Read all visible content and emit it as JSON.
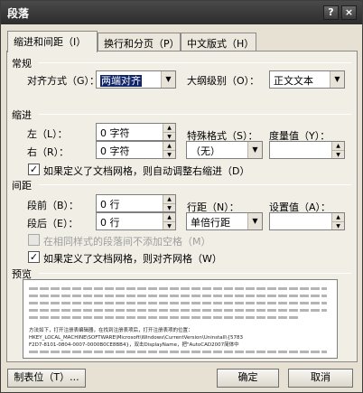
{
  "window": {
    "title": "段落",
    "help_label": "?",
    "close_label": "×"
  },
  "tabs": [
    {
      "label": "缩进和间距（I）",
      "active": true
    },
    {
      "label": "换行和分页（P）",
      "active": false
    },
    {
      "label": "中文版式（H）",
      "active": false
    }
  ],
  "general": {
    "heading": "常规",
    "alignment_label": "对齐方式（G）：",
    "alignment_value": "两端对齐",
    "outline_label": "大纲级别（O）：",
    "outline_value": "正文文本"
  },
  "indent": {
    "heading": "缩进",
    "left_label": "左（L）：",
    "left_value": "0 字符",
    "right_label": "右（R）：",
    "right_value": "0 字符",
    "special_label": "特殊格式（S）：",
    "special_value": "（无）",
    "measure_label": "度量值（Y）：",
    "measure_value": "",
    "auto_adjust_label": "如果定义了文档网格，则自动调整右缩进（D）",
    "auto_adjust_checked": true
  },
  "spacing": {
    "heading": "间距",
    "before_label": "段前（B）：",
    "before_value": "0 行",
    "after_label": "段后（E）：",
    "after_value": "0 行",
    "line_spacing_label": "行距（N）：",
    "line_spacing_value": "单倍行距",
    "set_value_label": "设置值（A）：",
    "set_value_value": "",
    "no_space_label": "在相同样式的段落间不添加空格（M）",
    "no_space_checked": false,
    "no_space_disabled": true,
    "snap_grid_label": "如果定义了文档网格，则对齐网格（W）",
    "snap_grid_checked": true
  },
  "preview": {
    "heading": "预览",
    "text_lines": [
      "方法如下，打开注册表编辑器，在找到注册表项后，打开注册表项的位置：",
      "HKEY_LOCAL_MACHINE\\SOFTWARE\\Microsoft\\Windows\\CurrentVersion\\Uninstall\\{5783",
      "F2D7-8101-0804-0007-0000B0CE8BB4}，双击DisplayName，把\"AutoCAD2007简体中"
    ]
  },
  "footer": {
    "tabs_button": "制表位（T）...",
    "ok_button": "确定",
    "cancel_button": "取消"
  },
  "colors": {
    "titlebar": "#333333",
    "dialog_bg": "#e6e1d3",
    "selection": "#10246a"
  }
}
